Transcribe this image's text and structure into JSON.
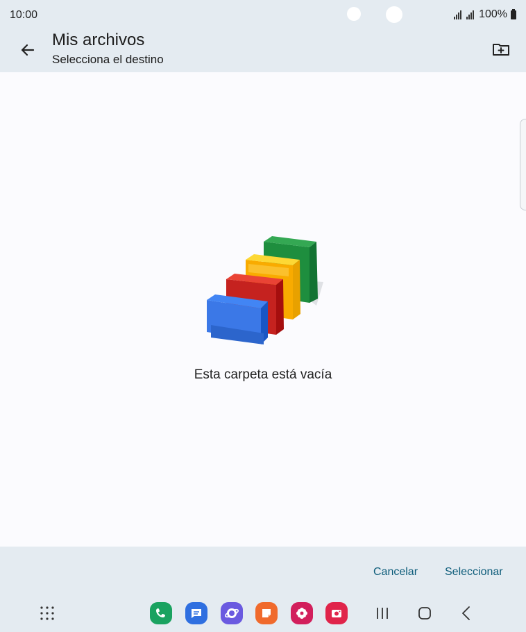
{
  "status_bar": {
    "time": "10:00",
    "battery": "100%"
  },
  "app_bar": {
    "title": "Mis archivos",
    "subtitle": "Selecciona el destino",
    "back_icon": "arrow-back-icon",
    "new_folder_icon": "create-folder-icon"
  },
  "content": {
    "empty_message": "Esta carpeta está vacía",
    "illustration": "empty-folders-illustration"
  },
  "footer": {
    "cancel_label": "Cancelar",
    "select_label": "Seleccionar"
  },
  "nav_bar": {
    "apps": [
      "phone-icon",
      "messages-icon",
      "internet-icon",
      "notes-icon",
      "gallery-icon",
      "camera-icon"
    ],
    "keys": [
      "recents-icon",
      "home-icon",
      "back-icon"
    ]
  },
  "colors": {
    "accent": "#0d5c7a",
    "chrome": "#e4ebf1",
    "surface": "#fbfbfe"
  }
}
